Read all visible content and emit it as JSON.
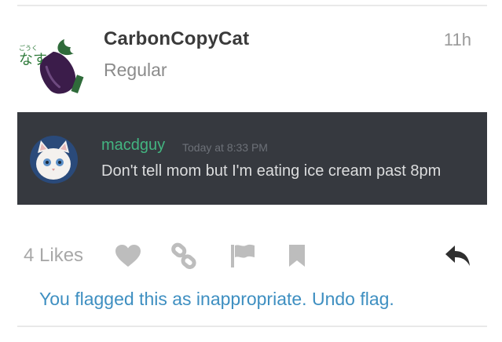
{
  "post": {
    "username": "CarbonCopyCat",
    "user_title": "Regular",
    "age": "11h",
    "avatar": {
      "icon": "eggplant-avatar-icon",
      "caption_small": "ごうく",
      "caption_large": "なす"
    }
  },
  "embed": {
    "username": "macdguy",
    "timestamp": "Today at 8:33 PM",
    "message": "Don't tell mom but I'm eating ice cream past 8pm",
    "avatar_icon": "white-cat-avatar-icon"
  },
  "actions": {
    "likes_label": "4 Likes",
    "icons": [
      "heart-icon",
      "link-icon",
      "flag-icon",
      "bookmark-icon",
      "reply-icon"
    ]
  },
  "flag_notice": {
    "message": "You flagged this as inappropriate.",
    "undo_label": "Undo flag."
  },
  "colors": {
    "embed_bg": "#36393f",
    "embed_username": "#43b581",
    "notice_link": "#3e8fc1",
    "icon_gray": "#bdbdbd",
    "reply_icon": "#2f2f2f"
  }
}
